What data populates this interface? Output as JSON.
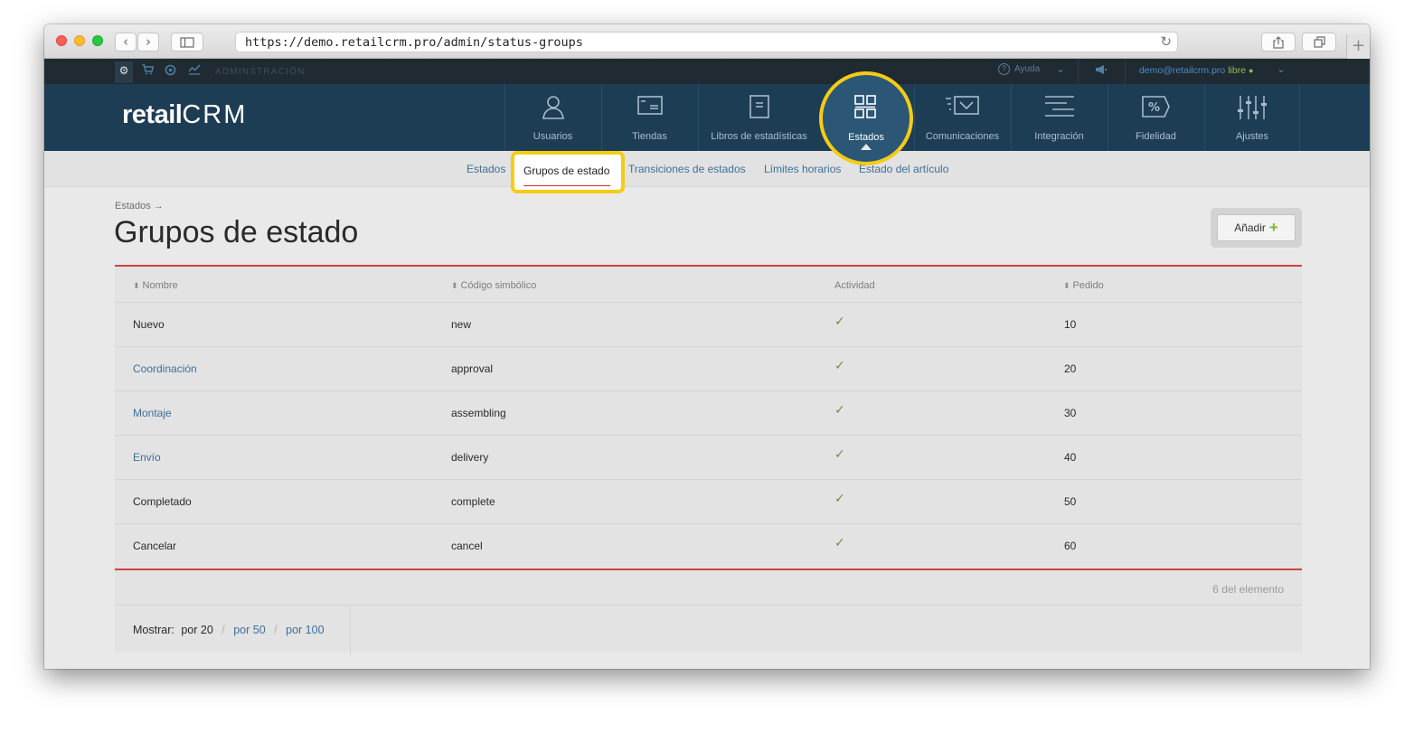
{
  "browser": {
    "url": "https://demo.retailcrm.pro/admin/status-groups"
  },
  "topbar": {
    "admin_label": "ADMINSTRACIÓN",
    "help_label": "Ayuda",
    "user_email": "demo@retailcrm.pro",
    "user_plan": "libre"
  },
  "logo": {
    "text_a": "retail",
    "text_b": "CRM"
  },
  "nav": {
    "items": [
      {
        "label": "Usuarios",
        "icon": "user-icon"
      },
      {
        "label": "Tiendas",
        "icon": "store-icon"
      },
      {
        "label": "Libros de estadísticas",
        "icon": "book-icon"
      },
      {
        "label": "Estados",
        "icon": "grid-icon",
        "active": true
      },
      {
        "label": "Comunicaciones",
        "icon": "mail-icon"
      },
      {
        "label": "Integración",
        "icon": "integration-icon"
      },
      {
        "label": "Fidelidad",
        "icon": "percent-icon"
      },
      {
        "label": "Ajustes",
        "icon": "sliders-icon"
      }
    ]
  },
  "subnav": {
    "items": [
      "Estados",
      "Grupos de estado",
      "Transiciones de estados",
      "Límites horarios",
      "Estado del artículo"
    ],
    "active": "Grupos de estado"
  },
  "page": {
    "breadcrumb": "Estados →",
    "title": "Grupos de estado",
    "add_label": "Añadir"
  },
  "table": {
    "headers": [
      "Nombre",
      "Código simbólico",
      "Actividad",
      "Pedido"
    ],
    "rows": [
      {
        "name": "Nuevo",
        "code": "new",
        "active": "✓",
        "order": "10",
        "link": false
      },
      {
        "name": "Coordinación",
        "code": "approval",
        "active": "✓",
        "order": "20",
        "link": true
      },
      {
        "name": "Montaje",
        "code": "assembling",
        "active": "✓",
        "order": "30",
        "link": true
      },
      {
        "name": "Envío",
        "code": "delivery",
        "active": "✓",
        "order": "40",
        "link": true
      },
      {
        "name": "Completado",
        "code": "complete",
        "active": "✓",
        "order": "50",
        "link": false
      },
      {
        "name": "Cancelar",
        "code": "cancel",
        "active": "✓",
        "order": "60",
        "link": false
      }
    ],
    "count_label": "6 del elemento",
    "show_label": "Mostrar:",
    "per_current": "por 20",
    "per_options": [
      "por 50",
      "por 100"
    ]
  },
  "colors": {
    "nav_bg": "#1d3d55",
    "highlight": "#f5cc14",
    "accent_red": "#cf4242",
    "link": "#3e6f98",
    "success": "#7ab52e"
  }
}
